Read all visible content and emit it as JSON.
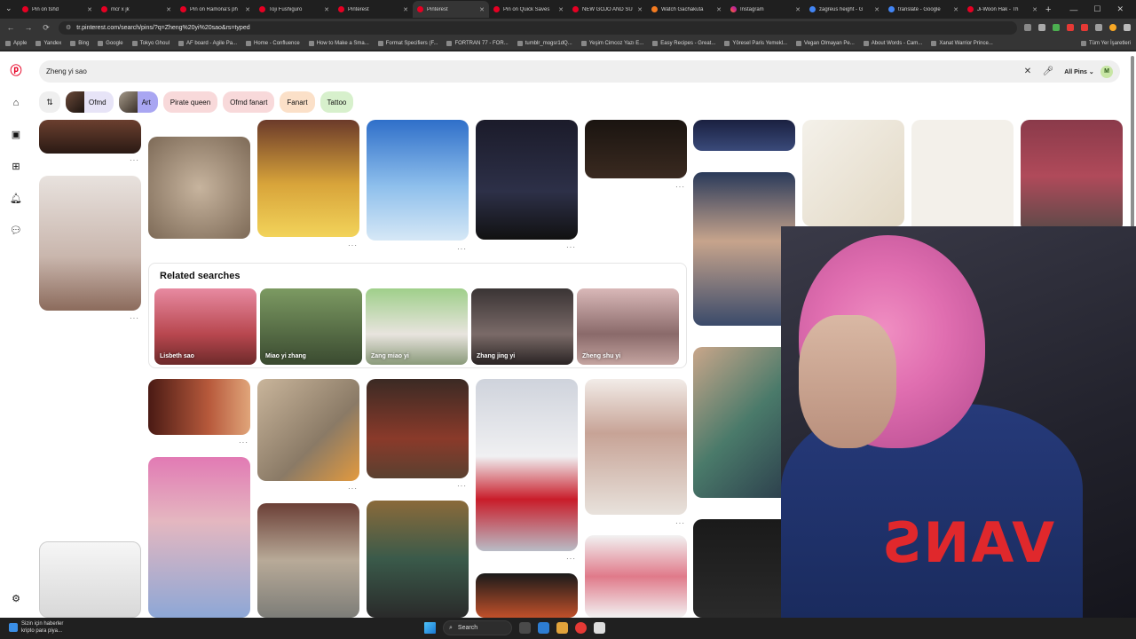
{
  "browser": {
    "tabs": [
      {
        "label": "Pin on tshd",
        "icon": "pinterest-icon"
      },
      {
        "label": "mcr x jk",
        "icon": "pinterest-icon"
      },
      {
        "label": "Pin on Ramona's ph",
        "icon": "pinterest-icon"
      },
      {
        "label": "Toji Fushiguro",
        "icon": "pinterest-icon"
      },
      {
        "label": "Pinterest",
        "icon": "pinterest-icon"
      },
      {
        "label": "Pinterest",
        "icon": "pinterest-icon",
        "active": true
      },
      {
        "label": "Pin on Quick Saves",
        "icon": "pinterest-icon"
      },
      {
        "label": "NEW GOJO AND SU",
        "icon": "pinterest-icon"
      },
      {
        "label": "Watch Gachakuta",
        "icon": "watch-icon"
      },
      {
        "label": "Instagram",
        "icon": "instagram-icon"
      },
      {
        "label": "zagreus height - G",
        "icon": "google-icon"
      },
      {
        "label": "translate - Google",
        "icon": "google-icon"
      },
      {
        "label": "Ji-Woon Hak - Th",
        "icon": "pinterest-icon"
      }
    ],
    "url": "tr.pinterest.com/search/pins/?q=Zheng%20yi%20sao&rs=typed",
    "bookmarks": [
      "Apple",
      "Yandex",
      "Bing",
      "Google",
      "Tokyo Ghoul",
      "AF board - Agile Pa...",
      "Home - Confluence",
      "How to Make a Sma...",
      "Format Specifiers (F...",
      "FORTRAN 77 - FOR...",
      "tumblr_mogsr1dQ...",
      "Yeşim Cimcoz Yazı E...",
      "Easy Recipes - Great...",
      "Yöresel Paris Yemekl...",
      "Vegan Olmayan Pe...",
      "About Words - Cam...",
      "Xanat Warrior Prince..."
    ],
    "all_bookmarks_label": "Tüm Yer İşaretleri"
  },
  "search": {
    "value": "Zheng yi sao",
    "filter_label": "All Pins",
    "avatar_letter": "M"
  },
  "chips": [
    {
      "label": "Ofmd"
    },
    {
      "label": "Art"
    },
    {
      "label": "Pirate queen"
    },
    {
      "label": "Ofmd fanart"
    },
    {
      "label": "Fanart"
    },
    {
      "label": "Tattoo"
    }
  ],
  "related": {
    "title": "Related searches",
    "items": [
      {
        "label": "Lisbeth sao"
      },
      {
        "label": "Miao yi zhang"
      },
      {
        "label": "Zang miao yi"
      },
      {
        "label": "Zhang jing yi"
      },
      {
        "label": "Zheng shu yi"
      }
    ]
  },
  "webcam": {
    "shirt_text": "VANS"
  },
  "taskbar": {
    "news_title": "Sizin için haberler",
    "news_sub": "kripto para piya...",
    "search_label": "Search"
  },
  "colors": {
    "pinterest_red": "#e60023",
    "chip_purple": "#a9a6f2",
    "chip_pink": "#f8d9da"
  }
}
